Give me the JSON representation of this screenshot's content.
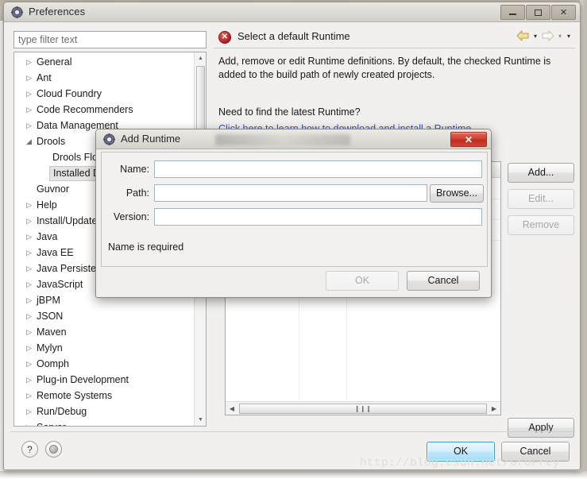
{
  "window": {
    "title": "Preferences",
    "icon": "gear-icon",
    "minimize_label": "–",
    "maximize_label": "□",
    "close_label": "✕"
  },
  "sidebar": {
    "filter_placeholder": "type filter text",
    "filter_value": "",
    "items": [
      {
        "label": "General",
        "twisty": "▷",
        "level": 1,
        "selected": false
      },
      {
        "label": "Ant",
        "twisty": "▷",
        "level": 1,
        "selected": false
      },
      {
        "label": "Cloud Foundry",
        "twisty": "▷",
        "level": 1,
        "selected": false
      },
      {
        "label": "Code Recommenders",
        "twisty": "▷",
        "level": 1,
        "selected": false
      },
      {
        "label": "Data Management",
        "twisty": "▷",
        "level": 1,
        "selected": false
      },
      {
        "label": "Drools",
        "twisty": "◢",
        "level": 1,
        "selected": false
      },
      {
        "label": "Drools Flow",
        "twisty": "",
        "level": 2,
        "selected": false
      },
      {
        "label": "Installed Drools Runtimes",
        "twisty": "",
        "level": 2,
        "selected": true
      },
      {
        "label": "Guvnor",
        "twisty": "",
        "level": 1,
        "selected": false
      },
      {
        "label": "Help",
        "twisty": "▷",
        "level": 1,
        "selected": false
      },
      {
        "label": "Install/Update",
        "twisty": "▷",
        "level": 1,
        "selected": false
      },
      {
        "label": "Java",
        "twisty": "▷",
        "level": 1,
        "selected": false
      },
      {
        "label": "Java EE",
        "twisty": "▷",
        "level": 1,
        "selected": false
      },
      {
        "label": "Java Persistence",
        "twisty": "▷",
        "level": 1,
        "selected": false
      },
      {
        "label": "JavaScript",
        "twisty": "▷",
        "level": 1,
        "selected": false
      },
      {
        "label": "jBPM",
        "twisty": "▷",
        "level": 1,
        "selected": false
      },
      {
        "label": "JSON",
        "twisty": "▷",
        "level": 1,
        "selected": false
      },
      {
        "label": "Maven",
        "twisty": "▷",
        "level": 1,
        "selected": false
      },
      {
        "label": "Mylyn",
        "twisty": "▷",
        "level": 1,
        "selected": false
      },
      {
        "label": "Oomph",
        "twisty": "▷",
        "level": 1,
        "selected": false
      },
      {
        "label": "Plug-in Development",
        "twisty": "▷",
        "level": 1,
        "selected": false
      },
      {
        "label": "Remote Systems",
        "twisty": "▷",
        "level": 1,
        "selected": false
      },
      {
        "label": "Run/Debug",
        "twisty": "▷",
        "level": 1,
        "selected": false
      },
      {
        "label": "Server",
        "twisty": "▷",
        "level": 1,
        "selected": false
      }
    ],
    "scroll_up_icon": "▲",
    "scroll_down_icon": "▼"
  },
  "page": {
    "status_icon": "error-icon",
    "status_icon_glyph": "✕",
    "title": "Select a default Runtime",
    "description": "Add, remove or edit Runtime definitions. By default, the checked Runtime is added to the build path of newly created projects.",
    "question": "Need to find the latest Runtime?",
    "link": "Click here to learn how to download and install a Runtime",
    "nav": {
      "back_icon": "⇦",
      "back_menu_icon": "▾",
      "forward_icon": "⇨",
      "forward_menu_icon": "▾",
      "view_menu_icon": "▾"
    },
    "buttons": {
      "add": "Add...",
      "edit": "Edit...",
      "remove": "Remove",
      "apply": "Apply"
    },
    "table_scroll": {
      "left_icon": "◀",
      "right_icon": "▶",
      "grip_icon": "❙❙❙"
    }
  },
  "footer": {
    "help_icon": "?",
    "shell_icon": "shell-button",
    "ok": "OK",
    "cancel": "Cancel"
  },
  "watermark": "http://blog.csdn.net/GroFrey",
  "modal": {
    "title": "Add Runtime",
    "icon": "gear-icon",
    "close_label": "✕",
    "fields": [
      {
        "label": "Name:",
        "value": "",
        "placeholder": ""
      },
      {
        "label": "Path:",
        "value": "",
        "placeholder": ""
      },
      {
        "label": "Version:",
        "value": "",
        "placeholder": ""
      }
    ],
    "browse": "Browse...",
    "message": "Name is required",
    "ok": "OK",
    "cancel": "Cancel"
  }
}
